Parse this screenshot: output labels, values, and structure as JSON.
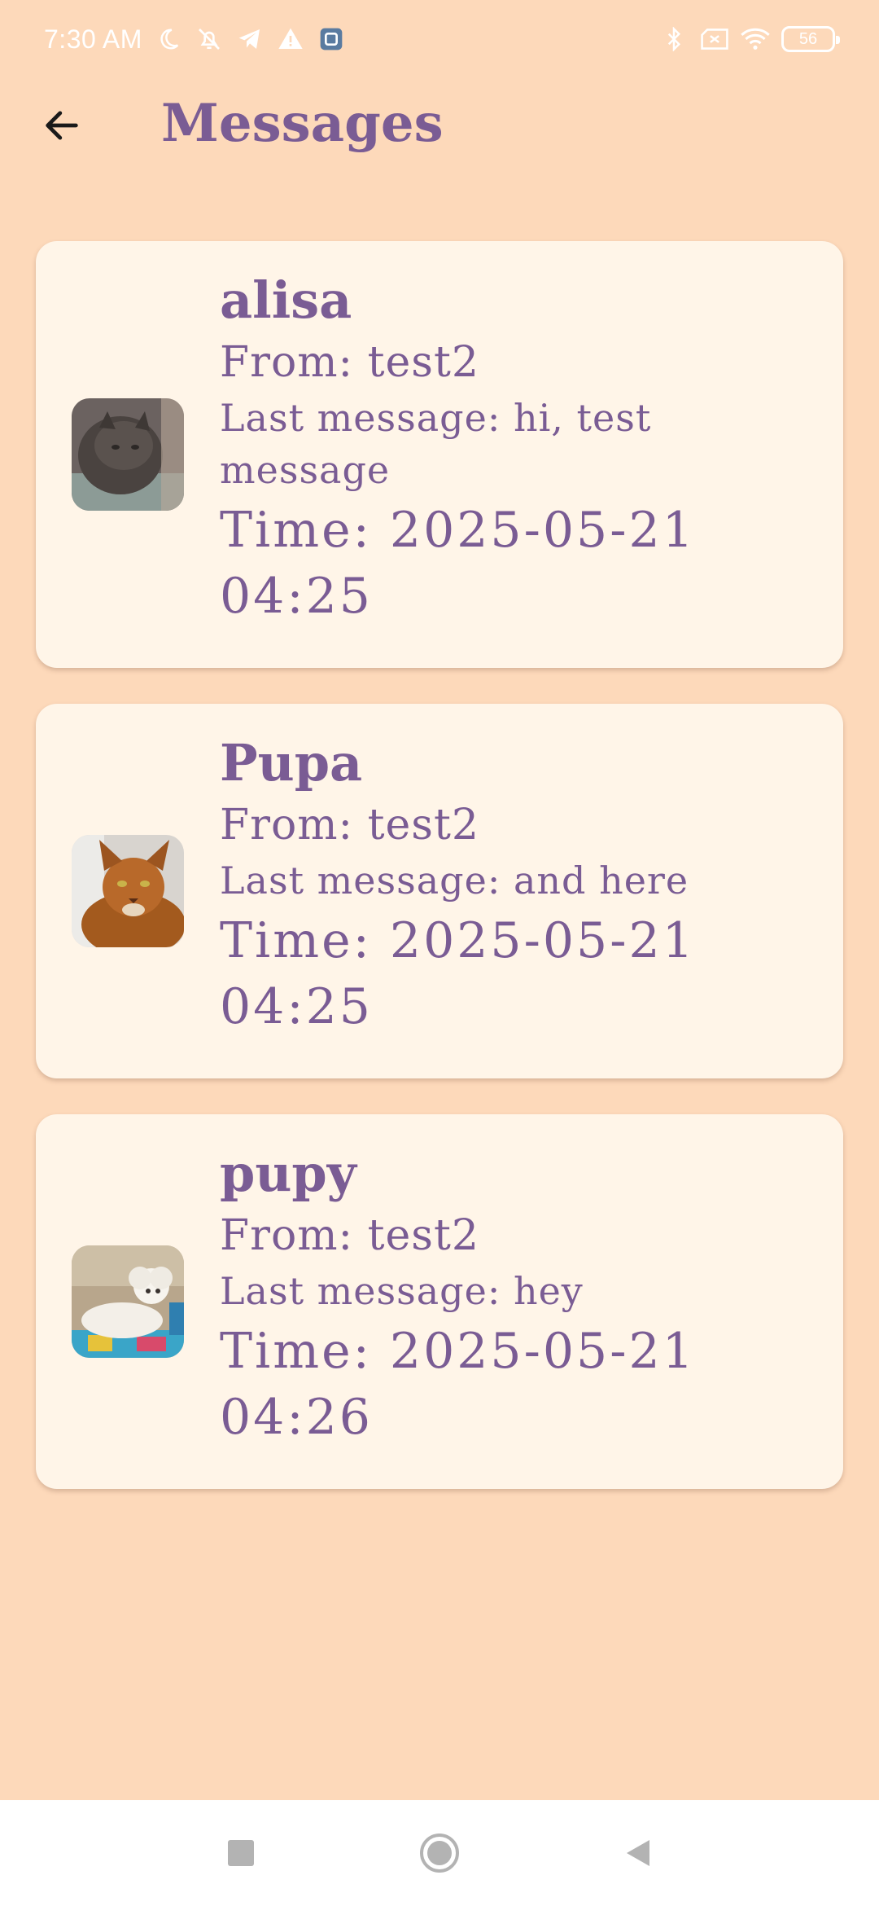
{
  "status_bar": {
    "time": "7:30 AM",
    "battery": "56",
    "icons": [
      "moon-icon",
      "muted-vibrate-icon",
      "telegram-icon",
      "warning-icon",
      "app-notification-icon",
      "bluetooth-icon",
      "no-sim-icon",
      "wifi-icon",
      "battery-icon"
    ]
  },
  "app_bar": {
    "title": "Messages",
    "back_icon": "arrow-left-icon"
  },
  "messages": [
    {
      "name": "alisa",
      "from": "From: test2",
      "last_message": "Last message: hi, test message",
      "time": "Time: 2025-05-21 04:25",
      "avatar": "gray-cat-photo"
    },
    {
      "name": "Pupa",
      "from": "From: test2",
      "last_message": "Last message: and here",
      "time": "Time: 2025-05-21 04:25",
      "avatar": "ginger-cat-photo"
    },
    {
      "name": "pupy",
      "from": "From: test2",
      "last_message": "Last message: hey",
      "time": "Time: 2025-05-21 04:26",
      "avatar": "white-poodle-photo"
    }
  ],
  "nav_bar": {
    "icons": [
      "recents-square-icon",
      "home-circle-icon",
      "back-triangle-icon"
    ]
  },
  "colors": {
    "background": "#FDD9BA",
    "card": "#FFF5E8",
    "accent_text": "#7A5C94",
    "nav_bar": "#FFFFFF"
  }
}
